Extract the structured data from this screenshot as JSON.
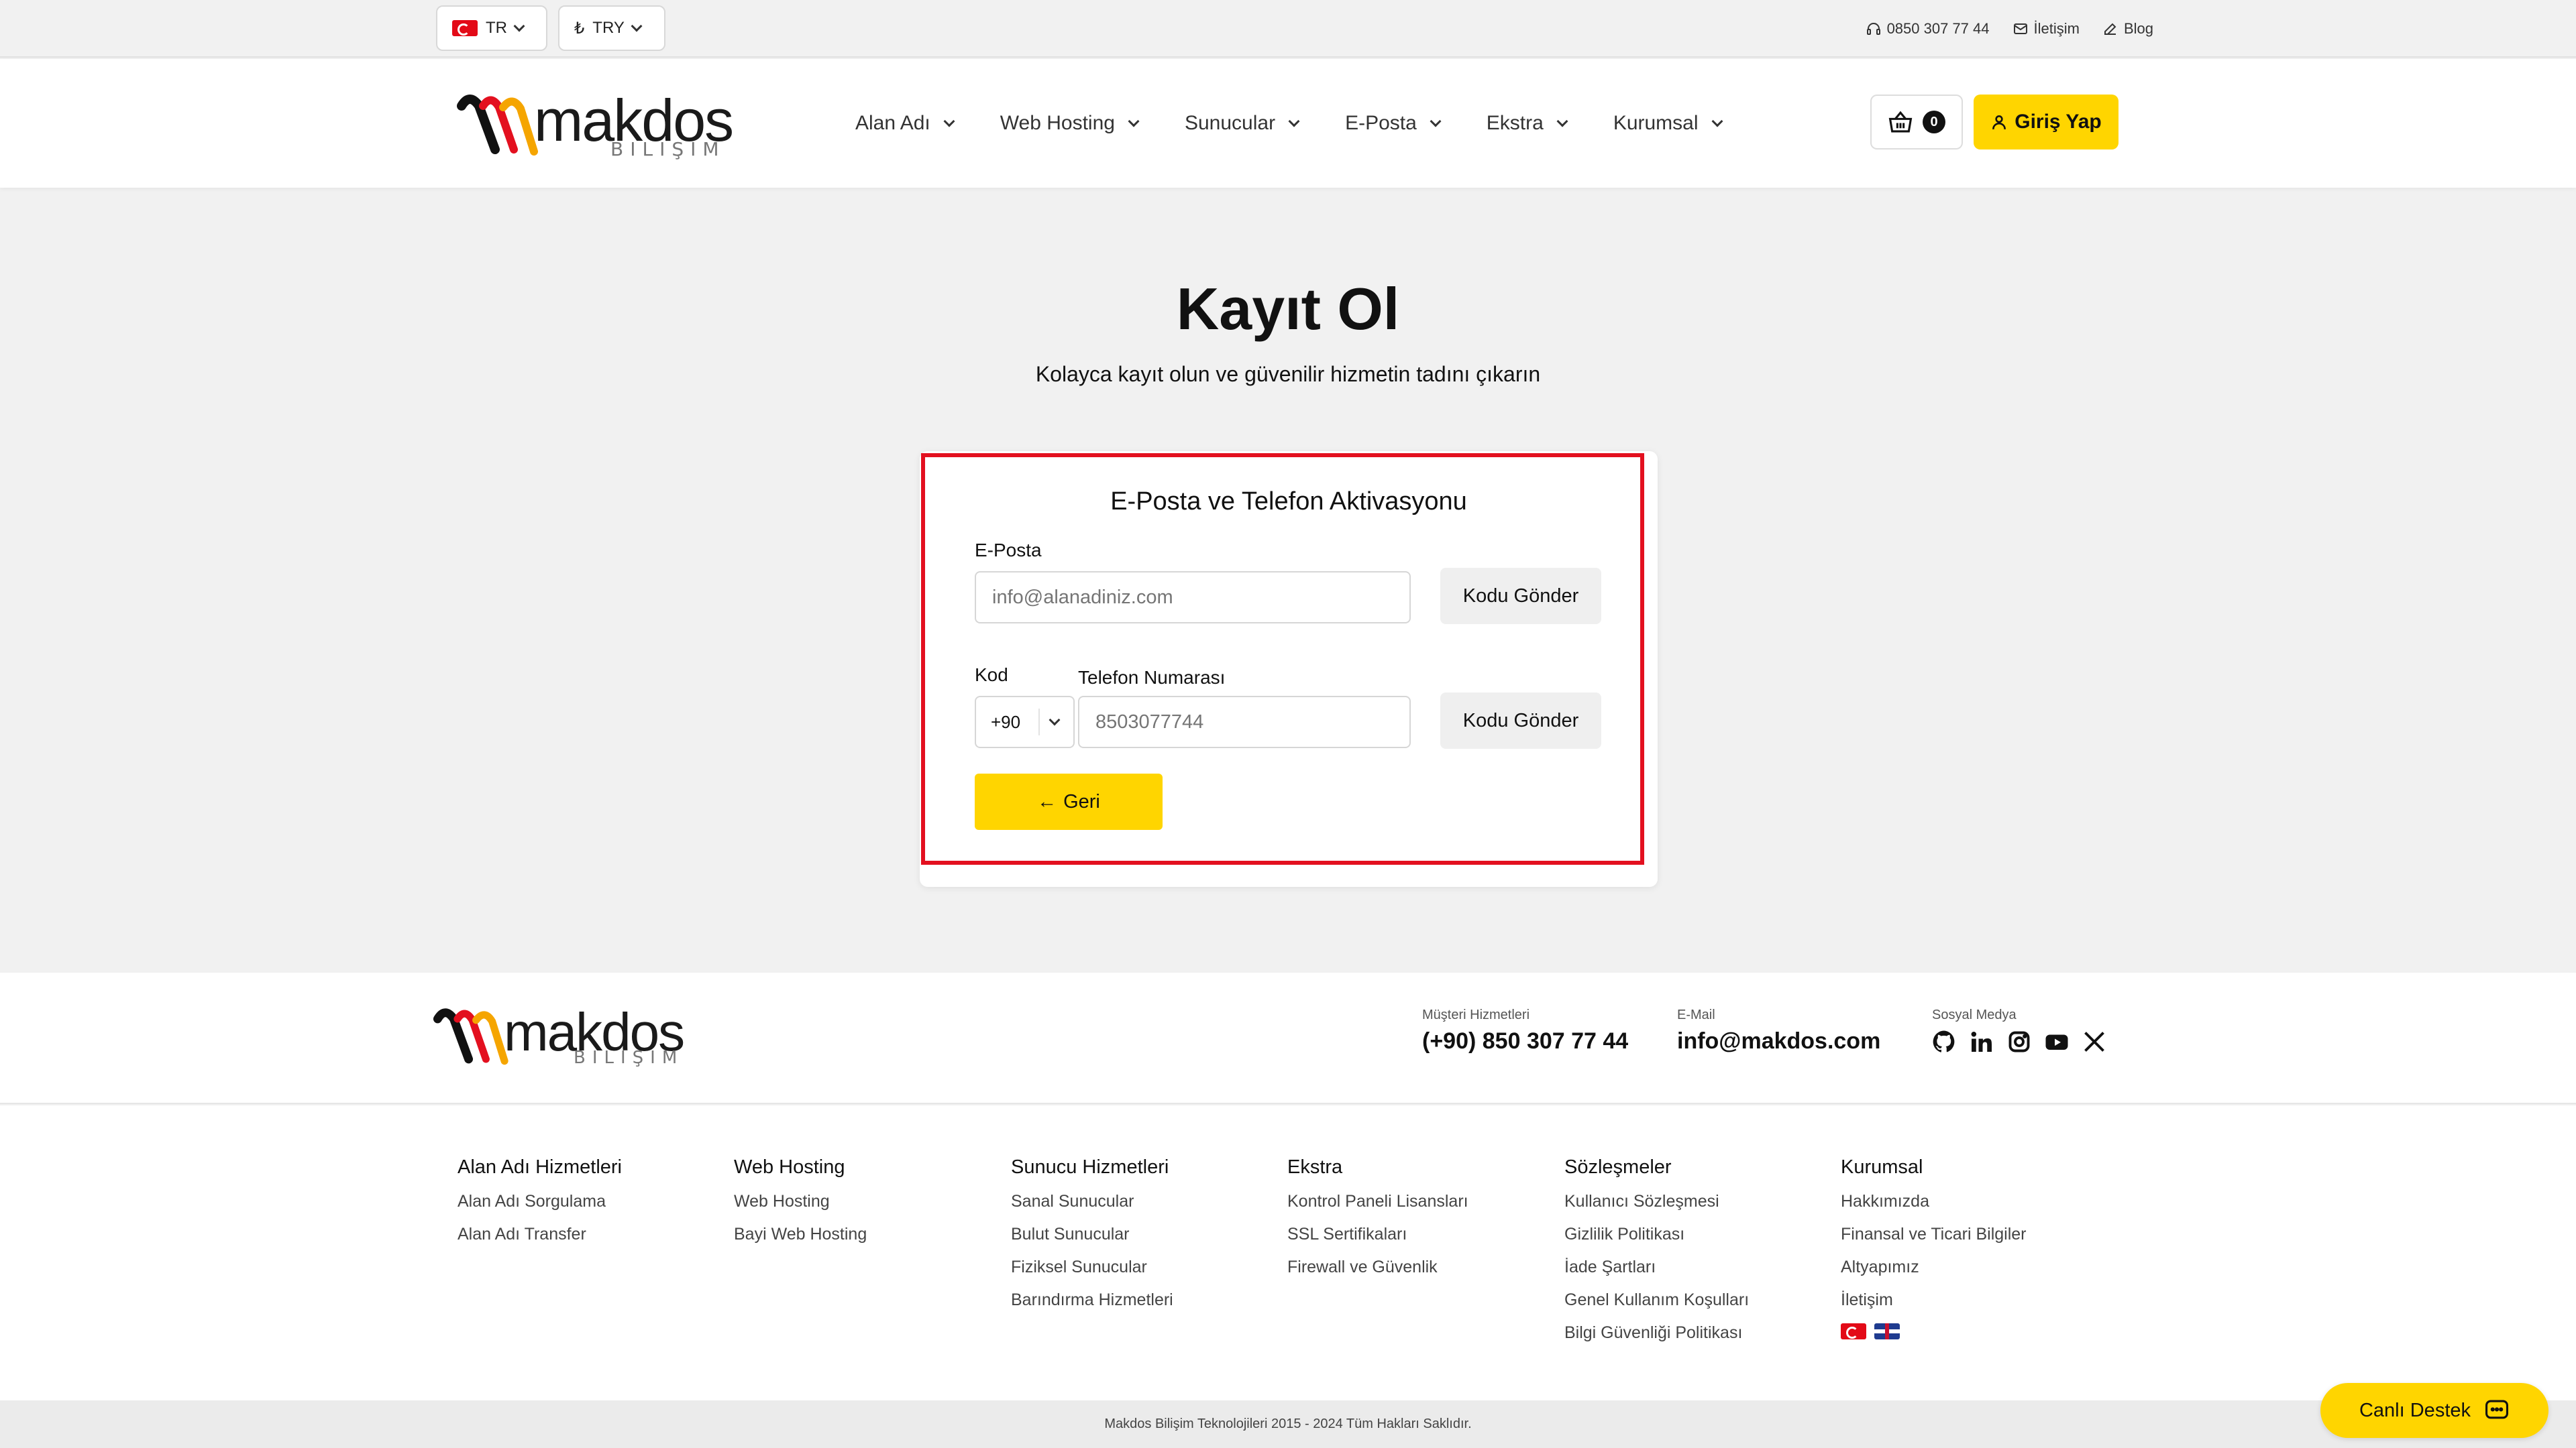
{
  "topbar": {
    "language": "TR",
    "currency": "TRY",
    "currency_symbol": "₺",
    "phone": "0850 307 77 44",
    "contact": "İletişim",
    "blog": "Blog"
  },
  "brand": {
    "word": "makdos",
    "sub": "BILIŞIM"
  },
  "nav": {
    "items": [
      "Alan Adı",
      "Web Hosting",
      "Sunucular",
      "E-Posta",
      "Ekstra",
      "Kurumsal"
    ],
    "cart_count": "0",
    "login": "Giriş Yap"
  },
  "main": {
    "title": "Kayıt Ol",
    "subtitle": "Kolayca kayıt olun ve güvenilir hizmetin tadını çıkarın",
    "card_title": "E-Posta ve Telefon Aktivasyonu",
    "email_label": "E-Posta",
    "email_placeholder": "info@alanadiniz.com",
    "send_code": "Kodu Gönder",
    "code_label": "Kod",
    "phone_label": "Telefon Numarası",
    "country_code": "+90",
    "phone_placeholder": "8503077744",
    "back": "Geri"
  },
  "footer": {
    "support_label": "Müşteri Hizmetleri",
    "support_value": "(+90) 850 307 77 44",
    "email_label": "E-Mail",
    "email_value": "info@makdos.com",
    "social_label": "Sosyal Medya",
    "columns": [
      {
        "title": "Alan Adı Hizmetleri",
        "links": [
          "Alan Adı Sorgulama",
          "Alan Adı Transfer"
        ]
      },
      {
        "title": "Web Hosting",
        "links": [
          "Web Hosting",
          "Bayi Web Hosting"
        ]
      },
      {
        "title": "Sunucu Hizmetleri",
        "links": [
          "Sanal Sunucular",
          "Bulut Sunucular",
          "Fiziksel Sunucular",
          "Barındırma Hizmetleri"
        ]
      },
      {
        "title": "Ekstra",
        "links": [
          "Kontrol Paneli Lisansları",
          "SSL Sertifikaları",
          "Firewall ve Güvenlik"
        ]
      },
      {
        "title": "Sözleşmeler",
        "links": [
          "Kullanıcı Sözleşmesi",
          "Gizlilik Politikası",
          "İade Şartları",
          "Genel Kullanım Koşulları",
          "Bilgi Güvenliği Politikası"
        ]
      },
      {
        "title": "Kurumsal",
        "links": [
          "Hakkımızda",
          "Finansal ve Ticari Bilgiler",
          "Altyapımız",
          "İletişim"
        ]
      }
    ],
    "copyright": "Makdos Bilişim Teknolojileri 2015 - 2024 Tüm Hakları Saklıdır.",
    "live_support": "Canlı Destek"
  },
  "colors": {
    "accent": "#ffd500",
    "highlight": "#e3101f"
  }
}
